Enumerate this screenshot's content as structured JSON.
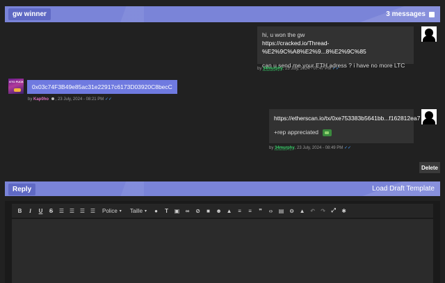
{
  "thread": {
    "title": "gw winner",
    "messages_count": "3 messages"
  },
  "messages": [
    {
      "lines": [
        "hi, u won the gw",
        "https://cracked.io/Thread-%E2%9C%A8%E2%9...8%E2%9C%85",
        "",
        "can u send me your ETH adress ? i have no more LTC"
      ],
      "meta_prefix": "by",
      "username": "34murphy",
      "date": ", 23 July, 2024 - 07:47 PM",
      "ticks": "✓✓"
    },
    {
      "text": "0x03c74F3B49e85ac31e22917c6173D03920C8becC",
      "meta_prefix": "by",
      "username": "Kap0ho",
      "date": ", 23 July, 2024 - 08:21 PM",
      "ticks": "✓✓",
      "avatar_text": "GTO FUCK"
    },
    {
      "lines": [
        "https://etherscan.io/tx/0xe753383b5641bb...f162812ea7",
        "",
        "+rep appreciated"
      ],
      "meta_prefix": "by",
      "username": "34murphy",
      "date": ", 23 July, 2024 - 08:49 PM",
      "ticks": "✓✓"
    }
  ],
  "actions": {
    "delete_label": "Delete"
  },
  "reply": {
    "label": "Reply",
    "load_draft_label": "Load Draft Template"
  },
  "editor": {
    "font_label": "Police",
    "size_label": "Taille"
  },
  "colors": {
    "accent": "#7a84d8",
    "bubble": "#6f7ae0",
    "green_user": "#38d26b"
  }
}
